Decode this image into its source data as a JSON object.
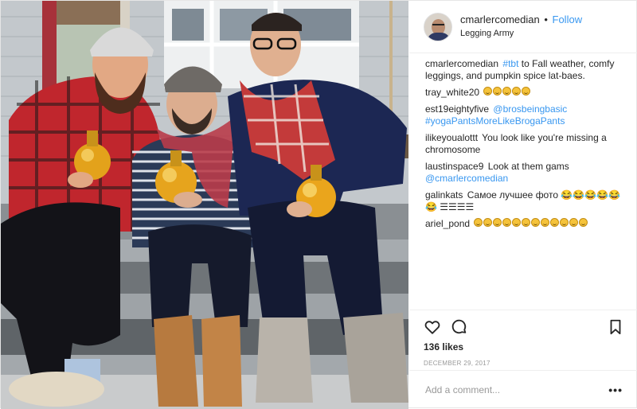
{
  "header": {
    "username": "cmarlercomedian",
    "separator": "•",
    "follow_label": "Follow",
    "location": "Legging Army"
  },
  "caption": {
    "username": "cmarlercomedian",
    "hashtag": "#tbt",
    "text": " to Fall weather, comfy leggings, and pumpkin spice lat-baes."
  },
  "comments": [
    {
      "username": "tray_white20",
      "text": "",
      "emoji_count": 5
    },
    {
      "username": "est19eightyfive",
      "mention": "@brosbeingbasic",
      "hashtag": "#yogaPantsMoreLikeBrogaPants"
    },
    {
      "username": "ilikeyoualottt",
      "text": "You look like you're missing a chromosome"
    },
    {
      "username": "laustinspace9",
      "text": "Look at them gams ",
      "mention": "@cmarlercomedian"
    },
    {
      "username": "galinkats",
      "text": "Самое лучшее фото 😂😂😂😂😂😂 ☰☰☰☰",
      "emoji_count": 6
    },
    {
      "username": "ariel_pond",
      "text": "",
      "emoji_count": 12
    }
  ],
  "actions": {
    "like_icon": "heart-icon",
    "comment_icon": "comment-icon",
    "save_icon": "bookmark-icon",
    "likes": "136 likes",
    "date": "DECEMBER 29, 2017"
  },
  "add_comment": {
    "placeholder": "Add a comment...",
    "more_label": "•••"
  },
  "colors": {
    "link": "#3897f0",
    "text": "#262626",
    "muted": "#999999",
    "border": "#efefef"
  }
}
